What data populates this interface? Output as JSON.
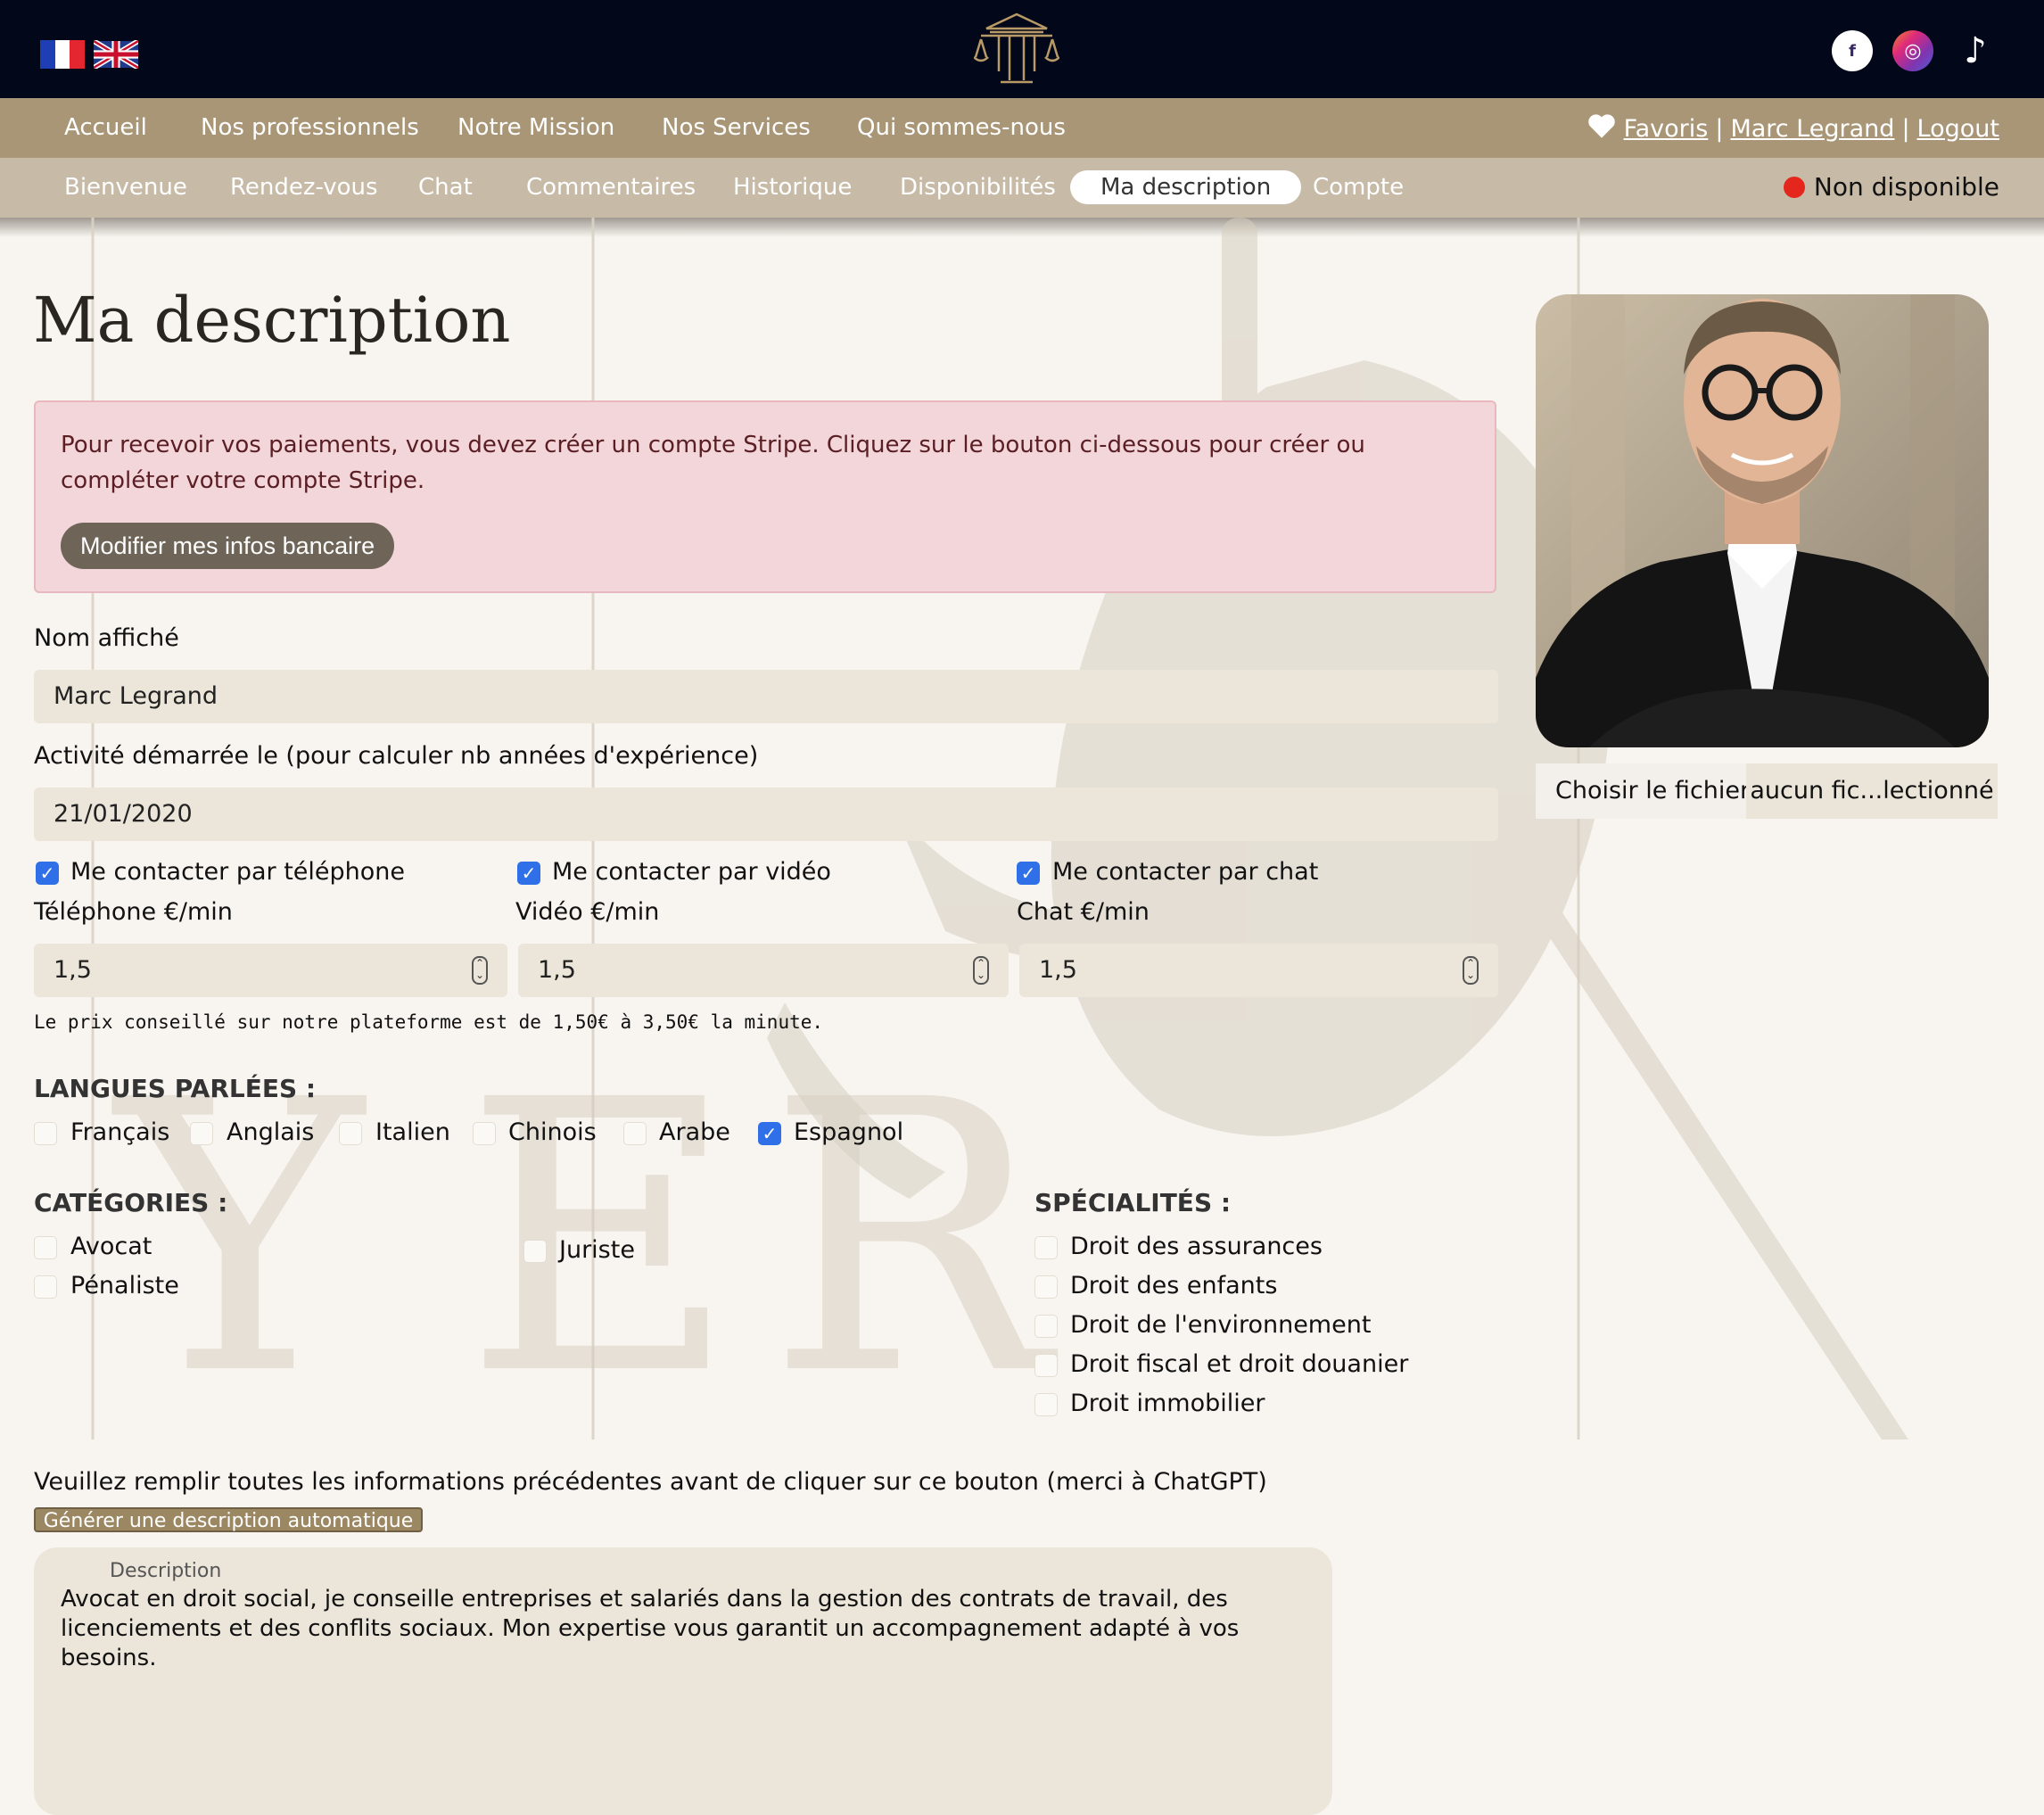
{
  "colors": {
    "topbar": "#03071a",
    "main_nav": "#a99676",
    "sub_nav": "#c7bba7",
    "alert_bg": "#f2d6d9",
    "checkbox_on": "#2f6fe8",
    "status_unavailable": "#e4261c"
  },
  "header": {
    "flags": [
      "flag-fr-icon",
      "flag-uk-icon"
    ],
    "logo": "courthouse-pillar-logo",
    "socials": [
      "facebook-icon",
      "instagram-icon",
      "tiktok-icon"
    ]
  },
  "main_nav": {
    "items": [
      "Accueil",
      "Nos professionnels",
      "Notre Mission",
      "Nos Services",
      "Qui sommes-nous"
    ],
    "favorites": "Favoris",
    "user": "Marc Legrand",
    "logout": "Logout",
    "sep": "|"
  },
  "sub_nav": {
    "items": [
      "Bienvenue",
      "Rendez-vous",
      "Chat",
      "Commentaires",
      "Historique",
      "Disponibilités",
      "Ma description",
      "Compte"
    ],
    "active": "Ma description",
    "status": "Non disponible"
  },
  "page": {
    "title": "Ma description"
  },
  "alert": {
    "text": "Pour recevoir vos paiements, vous devez créer un compte Stripe. Cliquez sur le bouton ci-dessous pour créer ou compléter votre compte Stripe.",
    "button": "Modifier mes infos bancaire"
  },
  "form": {
    "name_label": "Nom affiché",
    "name_value": "Marc Legrand",
    "start_label": "Activité démarrée le (pour calculer nb années d'expérience)",
    "start_value": "21/01/2020",
    "contact": {
      "phone": {
        "label": "Me contacter par téléphone",
        "checked": true,
        "price_label": "Téléphone €/min",
        "price": "1,5"
      },
      "video": {
        "label": "Me contacter par vidéo",
        "checked": true,
        "price_label": "Vidéo €/min",
        "price": "1,5"
      },
      "chat": {
        "label": "Me contacter par chat",
        "checked": true,
        "price_label": "Chat €/min",
        "price": "1,5"
      }
    },
    "price_hint": "Le prix conseillé sur notre plateforme est de 1,50€ à 3,50€ la minute."
  },
  "languages": {
    "heading": "LANGUES PARLÉES :",
    "items": [
      {
        "label": "Français",
        "checked": false
      },
      {
        "label": "Anglais",
        "checked": false
      },
      {
        "label": "Italien",
        "checked": false
      },
      {
        "label": "Chinois",
        "checked": false
      },
      {
        "label": "Arabe",
        "checked": false
      },
      {
        "label": "Espagnol",
        "checked": true
      }
    ]
  },
  "categories": {
    "heading": "CATÉGORIES :",
    "items": [
      {
        "label": "Avocat",
        "checked": false
      },
      {
        "label": "Pénaliste",
        "checked": false
      },
      {
        "label": "Juriste",
        "checked": false
      }
    ]
  },
  "specialties": {
    "heading": "SPÉCIALITÉS :",
    "items": [
      {
        "label": "Droit des assurances",
        "checked": false
      },
      {
        "label": "Droit des enfants",
        "checked": false
      },
      {
        "label": "Droit de l'environnement",
        "checked": false
      },
      {
        "label": "Droit fiscal et droit douanier",
        "checked": false
      },
      {
        "label": "Droit immobilier",
        "checked": false
      }
    ]
  },
  "profile": {
    "choose_file": "Choisir le fichier",
    "file_name": "aucun fic...lectionné"
  },
  "generator": {
    "hint": "Veuillez remplir toutes les informations précédentes avant de cliquer sur ce bouton (merci à ChatGPT)",
    "button": "Générer une description automatique"
  },
  "description": {
    "label": "Description",
    "text": "Avocat en droit social, je conseille entreprises et salariés dans la gestion des contrats de travail, des licenciements et des conflits sociaux. Mon expertise vous garantit un accompagnement adapté à vos besoins."
  }
}
